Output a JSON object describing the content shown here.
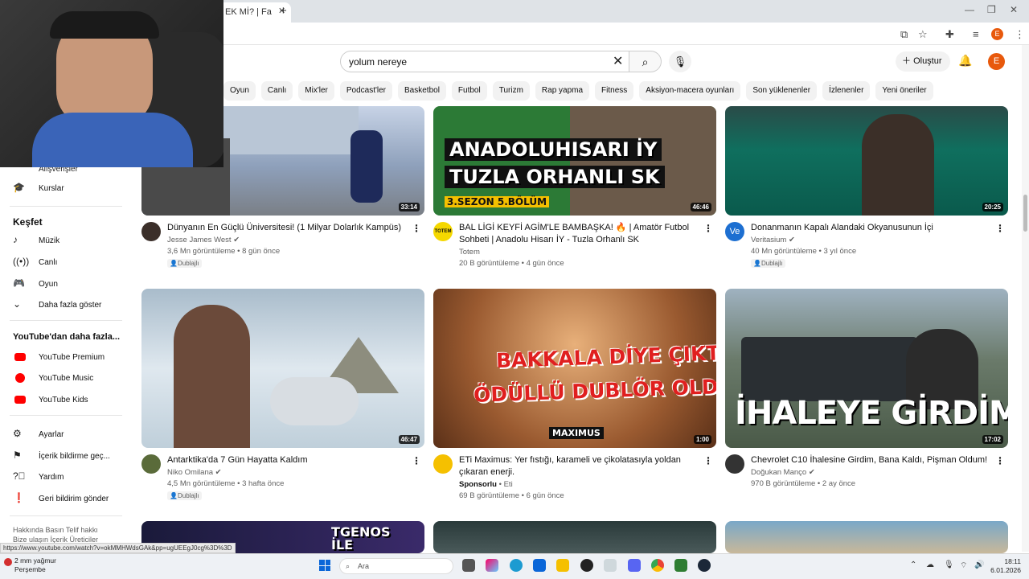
{
  "browser": {
    "tab_title": "EK Mİ? | Fa",
    "new_tab": "+",
    "profile_initial": "E"
  },
  "header": {
    "search_value": "yolum nereye",
    "create_label": "Oluştur",
    "avatar_initial": "E"
  },
  "chips": [
    "Oyun",
    "Canlı",
    "Mix'ler",
    "Podcast'ler",
    "Basketbol",
    "Futbol",
    "Turizm",
    "Rap yapma",
    "Fitness",
    "Aksiyon-macera oyunları",
    "Son yüklenenler",
    "İzlenenler",
    "Yeni öneriler"
  ],
  "sidebar": {
    "partial_item": "Alışverişler",
    "courses": "Kurslar",
    "explore_head": "Keşfet",
    "explore": [
      "Müzik",
      "Canlı",
      "Oyun",
      "Daha fazla göster"
    ],
    "more_head": "YouTube'dan daha fazla...",
    "more": [
      "YouTube Premium",
      "YouTube Music",
      "YouTube Kids"
    ],
    "settings": [
      "Ayarlar",
      "İçerik bildirme geç...",
      "Yardım",
      "Geri bildirim gönder"
    ],
    "footer_line1": "Hakkında  Basın  Telif hakkı",
    "footer_line2": "Bize ulaşın  İçerik Üreticiler"
  },
  "videos": [
    {
      "title": "Dünyanın En Güçlü Üniversitesi! (1 Milyar Dolarlık Kampüs)",
      "channel": "Jesse James West",
      "stats": "3,6 Mn görüntüleme • 8 gün önce",
      "duration": "33:14",
      "dubbed": "Dublajlı",
      "thumb_color": "#7a8aa6"
    },
    {
      "title": "BAL LİGİ KEYFİ AGİM'LE BAMBAŞKA! 🔥 | Amatör Futbol Sohbeti | Anadolu Hisarı İY - Tuzla Orhanlı SK",
      "channel": "Totem",
      "stats": "20 B görüntüleme • 4 gün önce",
      "duration": "46:46",
      "thumb_line1": "ANADOLUHISARI İY",
      "thumb_line2": "TUZLA ORHANLI SK",
      "thumb_line3": "3.SEZON 5.BÖLÜM",
      "avatar_text": "TOTEM",
      "thumb_color": "#2f7a3a"
    },
    {
      "title": "Donanmanın Kapalı Alandaki Okyanusunun İçi",
      "channel": "Veritasium",
      "stats": "40 Mn görüntüleme • 3 yıl önce",
      "duration": "20:25",
      "dubbed": "Dublajlı",
      "avatar_text": "Ve",
      "thumb_color": "#1f7a6a"
    },
    {
      "title": "Antarktika'da 7 Gün Hayatta Kaldım",
      "channel": "Niko Omilana",
      "stats": "4,5 Mn görüntüleme • 3 hafta önce",
      "duration": "46:47",
      "dubbed": "Dublajlı",
      "thumb_color": "#9fb3c4"
    },
    {
      "title": "ETi Maximus: Yer fıstığı, karameli ve çikolatasıyla yoldan çıkaran enerji.",
      "channel": "Eti",
      "sponsor": "Sponsorlu",
      "stats": "69 B görüntüleme • 6 gün önce",
      "duration": "1:00",
      "thumb_line1": "BAKKALA DİYE ÇIKTI,",
      "thumb_line2": "ÖDÜLLÜ DUBLÖR OLDU!",
      "thumb_brand": "MAXIMUS",
      "thumb_color": "#8a5a3a"
    },
    {
      "title": "Chevrolet C10 İhalesine Girdim, Bana Kaldı, Pişman Oldum!",
      "channel": "Doğukan Manço",
      "stats": "970 B görüntüleme • 2 ay önce",
      "duration": "17:02",
      "thumb_line1": "İHALEYE GİRDİM",
      "thumb_color": "#5a6a5a"
    }
  ],
  "bottom_row": {
    "thumb_text": "TGENOS İLE"
  },
  "status_url": "https://www.youtube.com/watch?v=okMMHWdsGAk&pp=ugUEEgJ0cg%3D%3D",
  "taskbar": {
    "weather_temp": "2 mm yağmur",
    "weather_day": "Perşembe",
    "search_label": "Ara",
    "time": "18:11",
    "date": "6.01.2026"
  },
  "colors": {
    "accent": "#ff0000",
    "avatar": "#e8590c",
    "chip_bg": "#f2f2f2"
  }
}
